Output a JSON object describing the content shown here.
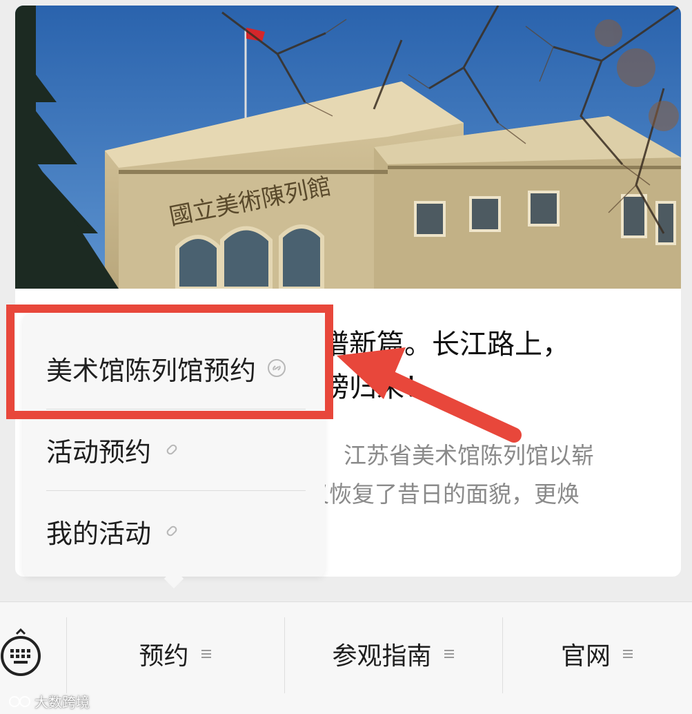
{
  "article": {
    "hero_sign": "國立美術陳列館",
    "title_line1": "谱新篇。长江路上，",
    "title_line2": "榜归来！",
    "summary_line1": "江苏省美术馆陈列馆以崭",
    "summary_line2": "又恢复了昔日的面貌，更焕"
  },
  "popup_menu": {
    "items": [
      {
        "label": "美术馆陈列馆预约",
        "icon": "link-icon"
      },
      {
        "label": "活动预约",
        "icon": "link-icon"
      },
      {
        "label": "我的活动",
        "icon": "link-icon"
      }
    ]
  },
  "bottom_menu": {
    "keyboard_icon": "keyboard-icon",
    "items": [
      {
        "label": "预约",
        "icon": "menu-lines-icon"
      },
      {
        "label": "参观指南",
        "icon": "menu-lines-icon"
      },
      {
        "label": "官网",
        "icon": "menu-lines-icon"
      }
    ]
  },
  "watermark": "大数跨境",
  "colors": {
    "annotation_red": "#e8473b",
    "sky_blue": "#2f6fb8",
    "building_stone": "#c9b98f",
    "page_bg": "#ededed"
  }
}
